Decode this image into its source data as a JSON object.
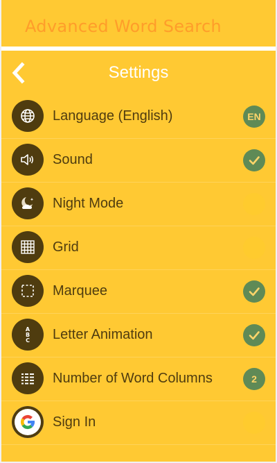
{
  "app": {
    "title": "Advanced Word Search"
  },
  "header": {
    "title": "Settings",
    "back_icon": "chevron-left-icon"
  },
  "colors": {
    "background": "#ffc933",
    "icon_circle": "#4f3c0f",
    "status_on": "#5f8a56",
    "status_text": "#ffd56a",
    "text": "#4f3c0f"
  },
  "settings": [
    {
      "label": "Language (English)",
      "icon": "globe-icon",
      "status": "EN",
      "state": "on"
    },
    {
      "label": "Sound",
      "icon": "speaker-icon",
      "status": "check",
      "state": "on"
    },
    {
      "label": "Night Mode",
      "icon": "moon-cloud-icon",
      "status": "",
      "state": "off"
    },
    {
      "label": "Grid",
      "icon": "grid-icon",
      "status": "",
      "state": "off"
    },
    {
      "label": "Marquee",
      "icon": "marquee-icon",
      "status": "check",
      "state": "on"
    },
    {
      "label": "Letter Animation",
      "icon": "letters-icon",
      "status": "check",
      "state": "on"
    },
    {
      "label": "Number of Word Columns",
      "icon": "columns-icon",
      "status": "2",
      "state": "on"
    },
    {
      "label": "Sign In",
      "icon": "google-icon",
      "status": "",
      "state": "off"
    }
  ]
}
